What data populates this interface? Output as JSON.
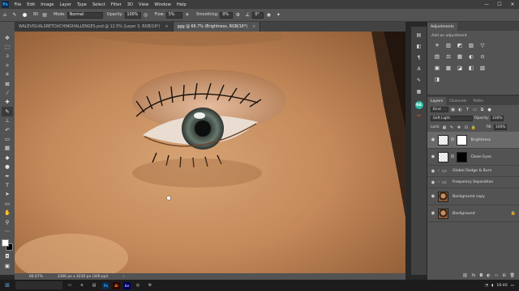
{
  "app": {
    "logo": "Ps"
  },
  "menu": [
    "File",
    "Edit",
    "Image",
    "Layer",
    "Type",
    "Select",
    "Filter",
    "3D",
    "View",
    "Window",
    "Help"
  ],
  "window_controls": {
    "minimize": "—",
    "maximize": "☐",
    "close": "✕"
  },
  "options": {
    "brush_size": "80",
    "mode_label": "Mode:",
    "mode_value": "Normal",
    "opacity_label": "Opacity:",
    "opacity_value": "100%",
    "flow_label": "Flow:",
    "flow_value": "5%",
    "smoothing_label": "Smoothing:",
    "smoothing_value": "0%",
    "angle_value": "0°"
  },
  "tabs": [
    {
      "label": "WALEVISUALSRETOUCHINGHALLENGES.psd @ 12.5% (Layer 3, RGB/16*)",
      "close": "×"
    },
    {
      "label": "ggg @ 66.7% (Brightness, RGB/16*)",
      "close": "×"
    }
  ],
  "status": {
    "zoom": "66.67%",
    "doc_size": "3366 px x 4230 px (300 ppi)",
    "arrow": "›"
  },
  "panels": {
    "adjustments_tab": "Adjustments",
    "add_adjustment_label": "Add an adjustment",
    "adjustment_icons": [
      "☀",
      "▥",
      "◩",
      "▨",
      "▽",
      "▤",
      "⚖",
      "▦",
      "◐",
      "⊙",
      "▣",
      "▩",
      "◪",
      "◧",
      "▧",
      "◨"
    ]
  },
  "layers": {
    "tabs": [
      "Layers",
      "Channels",
      "Paths"
    ],
    "kind_label": "Kind",
    "blend_mode": "Soft Light",
    "opacity_label": "Opacity:",
    "opacity_value": "100%",
    "lock_label": "Lock:",
    "fill_label": "Fill:",
    "fill_value": "100%",
    "items": [
      {
        "name": "Brightness"
      },
      {
        "name": "Clean Eyes"
      },
      {
        "name": "Global Dodge & Burn"
      },
      {
        "name": "Frequency Separation"
      },
      {
        "name": "Background copy"
      },
      {
        "name": "Background"
      }
    ]
  },
  "taskbar": {
    "search_placeholder": "",
    "apps": [
      {
        "label": "Ps",
        "bg": "#0f2a4a",
        "fg": "#31a8ff"
      },
      {
        "label": "Ai",
        "bg": "#330000",
        "fg": "#ff9a00"
      },
      {
        "label": "Ae",
        "bg": "#00005b",
        "fg": "#9999ff"
      }
    ],
    "time": "16:40"
  }
}
